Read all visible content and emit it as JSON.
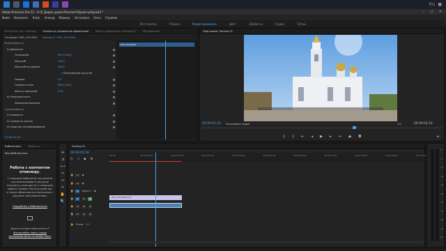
{
  "window_title": "Adobe Premiere Pro CC - H:\\5_Видео уроки Premiere\\Проекты\\Урок42 *",
  "menu": [
    "Файл",
    "Изменить",
    "Клип",
    "Эпизод",
    "Маркер",
    "Заголовок",
    "Окно",
    "Справка"
  ],
  "workspaces": [
    {
      "label": "Все панели",
      "active": false
    },
    {
      "label": "Сборка",
      "active": false
    },
    {
      "label": "Редактирование",
      "active": true
    },
    {
      "label": "Цвет",
      "active": false
    },
    {
      "label": "Эффекты",
      "active": false
    },
    {
      "label": "Аудио",
      "active": false
    },
    {
      "label": "Титры",
      "active": false
    }
  ],
  "left_tabs": [
    {
      "label": "Источник: (нет клипов)",
      "active": false
    },
    {
      "label": "Элементы управления эффектами",
      "active": true
    },
    {
      "label": "Микш. аудиоклипа: Эпизод 01",
      "active": false
    },
    {
      "label": "Метаданные",
      "active": false
    }
  ],
  "effect_controls": {
    "source_label": "Основной * МVI_3124.MOV",
    "sequence_label": "Эпизод 01 * MVI_3124.MOV",
    "clip_name": "MVI_3124.MOV",
    "rows": [
      {
        "label": "Видеоэффекты",
        "value": ""
      },
      {
        "label": "fx  Движение",
        "value": ""
      },
      {
        "label": "Положение",
        "value": "955,5    540,5"
      },
      {
        "label": "Масштаб",
        "value": "133,0"
      },
      {
        "label": "Масштаб по ширине",
        "value": "100,0"
      },
      {
        "label": "",
        "value": "✓ Равномерный масштаб"
      },
      {
        "label": "Поворот",
        "value": "0,0"
      },
      {
        "label": "Опорная точка",
        "value": "960,0    540,0"
      },
      {
        "label": "Фильтр мерцаний",
        "value": "0,00"
      },
      {
        "label": "fx  Непрозрачность",
        "value": ""
      },
      {
        "label": "Изменение времени",
        "value": ""
      },
      {
        "label": "Аудиоэффекты",
        "value": ""
      },
      {
        "label": "fx  Громкость",
        "value": ""
      },
      {
        "label": "fx  Громкость канала",
        "value": ""
      },
      {
        "label": "fx  Средство панорамирования",
        "value": ""
      }
    ],
    "timecode": "00:00:01:16"
  },
  "program": {
    "tab": "Программа: Эпизод 01",
    "timecode": "00:00:01:16",
    "fit": "По размеру кадра",
    "ratio": "1/2",
    "duration": "00:00:02:14"
  },
  "library": {
    "tabs": [
      "Библиотеки",
      "Эффекты"
    ],
    "name": "Моя библиотека",
    "heading": "Работа с контентом отовсюду.",
    "body": "С помощью библиотек вы можете систематизировать ресурсы, получать к ним доступ с помощью любого Creative Cloud-устройства, а также обмениваться ресурсами с другими пользователями.",
    "link": "Подробнее о библиотеках",
    "question": "Ищете конкретный контент?",
    "search_link": "Выполняйте поиск среди миллионов фото на Adobe Stock"
  },
  "timeline": {
    "tab": "Эпизод 01",
    "timecode": "00:00:01:16",
    "ruler": [
      "00:00",
      "00:00:01:00",
      "00:00:02:00",
      "00:00:03:00",
      "00:00:04:00",
      "00:00:05:00",
      "00:00:06:00",
      "00:00:07:00",
      "00:00:08:00",
      "00:00:09:00",
      "00:00:10:00"
    ],
    "tracks": [
      {
        "label": "V3",
        "type": "video"
      },
      {
        "label": "V2",
        "type": "video"
      },
      {
        "label": "V1",
        "type": "video",
        "name": "Видео 1"
      },
      {
        "label": "A1",
        "type": "audio"
      },
      {
        "label": "A2",
        "type": "audio"
      },
      {
        "label": "A3",
        "type": "audio"
      },
      {
        "label": "Основ.",
        "type": "master",
        "value": "0,0"
      }
    ],
    "video_clip": "MVI_3124.MOV [V]",
    "colors": {
      "video_clip": "#c9c4e8",
      "audio_clip": "#4a80b8",
      "playhead": "#4aa4f0"
    }
  },
  "meters": [
    "0",
    "-6",
    "-12",
    "-18",
    "-24",
    "-30",
    "-36",
    "-42",
    "-48",
    "-54",
    "dB"
  ],
  "taskbar": {
    "lang": "RU",
    "time": ""
  }
}
